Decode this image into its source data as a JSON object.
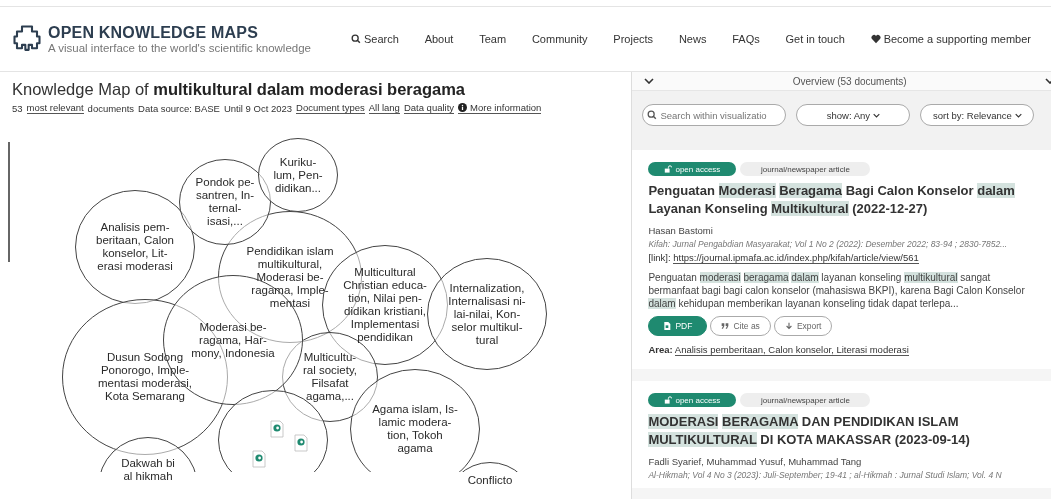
{
  "header": {
    "logo_title": "OPEN KNOWLEDGE MAPS",
    "logo_subtitle": "A visual interface to the world's scientific knowledge",
    "nav": [
      {
        "label": "Search",
        "kind": "search"
      },
      {
        "label": "About",
        "kind": "link"
      },
      {
        "label": "Team",
        "kind": "link"
      },
      {
        "label": "Community",
        "kind": "link"
      },
      {
        "label": "Projects",
        "kind": "link"
      },
      {
        "label": "News",
        "kind": "link"
      },
      {
        "label": "FAQs",
        "kind": "link"
      },
      {
        "label": "Get in touch",
        "kind": "link"
      },
      {
        "label": "Become a supporting member",
        "kind": "heart"
      }
    ]
  },
  "map": {
    "title_prefix": "Knowledge Map of",
    "title_query": "multikultural dalam moderasi beragama",
    "meta": [
      {
        "text": "53",
        "kind": "text"
      },
      {
        "text": "most relevant",
        "kind": "link"
      },
      {
        "text": "documents",
        "kind": "text"
      },
      {
        "text": "Data source: BASE",
        "kind": "text"
      },
      {
        "text": "Until 9 Oct 2023",
        "kind": "text"
      },
      {
        "text": "Document types",
        "kind": "link"
      },
      {
        "text": "All lang",
        "kind": "link"
      },
      {
        "text": "Data quality",
        "kind": "link"
      },
      {
        "text": "More information",
        "kind": "info"
      }
    ],
    "bubbles": [
      {
        "kind": "topic",
        "label": "Analisis pem-\nberitaan, Calon\nkonselor, Lit-\nerasi moderasi"
      },
      {
        "kind": "topic",
        "label": "Dusun Sodong\nPonorogo, Imple-\nmentasi moderasi,\nKota Semarang"
      },
      {
        "kind": "topic",
        "label": "Pendidikan islam\nmultikultural,\nModerasi be-\nragama, Imple-\nmentasi"
      },
      {
        "kind": "topic",
        "label": "Multicultural\nChristian educa-\ntion, Nilai pen-\ndidikan kristiani,\nImplementasi\npendidikan"
      },
      {
        "kind": "topic",
        "label": "Internalization,\nInternalisasi ni-\nlai-nilai, Kon-\nselor multikul-\ntural"
      },
      {
        "kind": "topic",
        "label": "Multicultu-\nral society,\nFilsafat\nagama,..."
      },
      {
        "kind": "topic",
        "label": "Moderasi be-\nragama, Har-\nmony, Indonesia"
      },
      {
        "kind": "documents"
      },
      {
        "kind": "topic",
        "label": "Agama islam, Is-\nlamic modera-\ntion, Tokoh\nagama"
      },
      {
        "kind": "topic",
        "label": "Pondok pe-\nsantren, In-\nternal-\nisasi,..."
      },
      {
        "kind": "topic",
        "label": "Kuriku-\nlum, Pen-\ndidikan..."
      },
      {
        "kind": "topic",
        "label": "Dakwah bi\nal hikmah"
      },
      {
        "kind": "topic",
        "label": "Conflicto"
      }
    ]
  },
  "list": {
    "overview": "Overview (53 documents)",
    "search": {
      "placeholder": "Search within visualizatio"
    },
    "filters": [
      {
        "label": "show: Any"
      },
      {
        "label": "sort by: Relevance"
      }
    ],
    "papers": [
      {
        "access": "open access",
        "type": "journal/newspaper article",
        "title": [
          {
            "text": "Penguatan",
            "highlight": false
          },
          {
            "text": "Moderasi",
            "highlight": true
          },
          {
            "text": "Beragama",
            "highlight": true
          },
          {
            "text": "Bagi Calon Konselor",
            "highlight": false
          },
          {
            "text": "dalam",
            "highlight": true
          },
          {
            "text": "Layanan Konseling",
            "highlight": false
          },
          {
            "text": "Multikultural",
            "highlight": true
          },
          {
            "text": "(2022-12-27)",
            "highlight": false
          }
        ],
        "authors": "Hasan Bastomi",
        "journal": "Kifah: Jurnal Pengabdian Masyarakat; Vol 1 No 2 (2022): Desember 2022; 83-94 ; 2830-7852...",
        "link_label": "[link]:",
        "link": "https://journal.ipmafa.ac.id/index.php/kifah/article/view/561",
        "abstract": [
          {
            "text": "Penguatan",
            "highlight": false
          },
          {
            "text": "moderasi",
            "highlight": true
          },
          {
            "text": "beragama",
            "highlight": true
          },
          {
            "text": "dalam",
            "highlight": true
          },
          {
            "text": "layanan konseling",
            "highlight": false
          },
          {
            "text": "multikultural",
            "highlight": true
          },
          {
            "text": "sangat bermanfaat bagi bagi calon konselor (mahasiswa BKPI), karena Bagi Calon Konselor",
            "highlight": false
          },
          {
            "text": "dalam",
            "highlight": true
          },
          {
            "text": "kehidupan memberikan layanan konseling tidak dapat terlepa...",
            "highlight": false
          }
        ],
        "actions": [
          {
            "label": "PDF",
            "kind": "pdf"
          },
          {
            "label": "Cite as",
            "kind": "cite"
          },
          {
            "label": "Export",
            "kind": "export"
          }
        ],
        "area_label": "Area:",
        "area": "Analisis pemberitaan, Calon konselor, Literasi moderasi"
      },
      {
        "access": "open access",
        "type": "journal/newspaper article",
        "title": [
          {
            "text": "MODERASI",
            "highlight": true
          },
          {
            "text": "BERAGAMA",
            "highlight": true
          },
          {
            "text": "DAN PENDIDIKAN ISLAM",
            "highlight": false
          },
          {
            "text": "MULTIKULTURAL",
            "highlight": true
          },
          {
            "text": "DI KOTA MAKASSAR (2023-09-14)",
            "highlight": false
          }
        ],
        "authors": "Fadli Syarief, Muhammad Yusuf, Muhammad Tang",
        "journal": "Al-Hikmah; Vol 4 No 3 (2023): Juli-September; 19-41 ; al-Hikmah : Jurnal Studi Islam; Vol. 4 N"
      }
    ]
  }
}
